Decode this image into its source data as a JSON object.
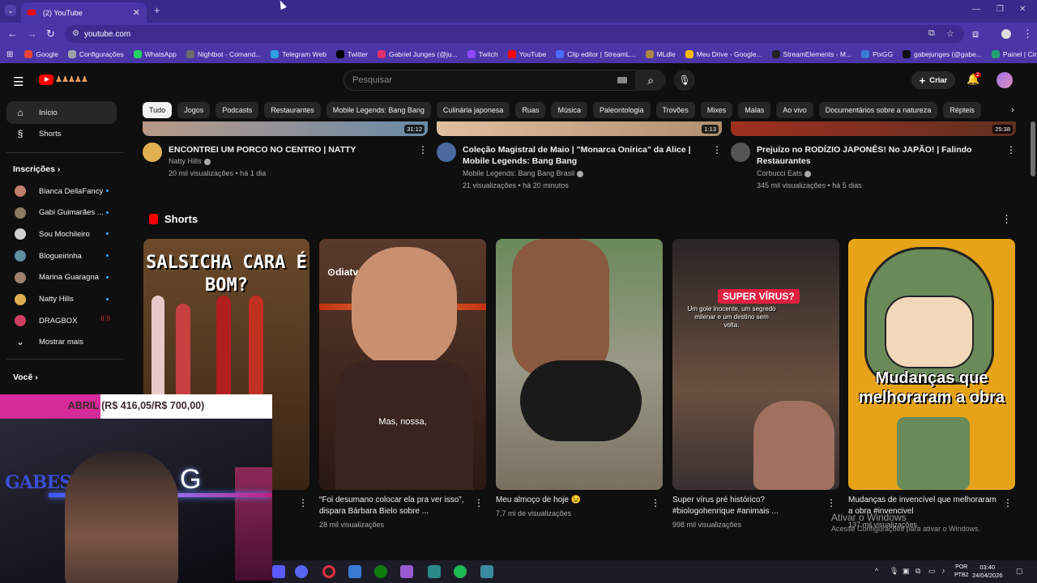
{
  "browser": {
    "tab_title": "(2) YouTube",
    "url": "youtube.com",
    "bookmarks": [
      {
        "label": "Google",
        "color": "#ea4335"
      },
      {
        "label": "Configurações",
        "color": "#9aa0a6"
      },
      {
        "label": "WhatsApp",
        "color": "#25d366"
      },
      {
        "label": "Nightbot - Comand...",
        "color": "#6b6b6b"
      },
      {
        "label": "Telegram Web",
        "color": "#2aa3e0"
      },
      {
        "label": "Twitter",
        "color": "#000000"
      },
      {
        "label": "Gabriel Junges (@ju...",
        "color": "#e1306c"
      },
      {
        "label": "Twitch",
        "color": "#9146ff"
      },
      {
        "label": "YouTube",
        "color": "#ff0000"
      },
      {
        "label": "Clip editor | StreamL...",
        "color": "#4b6cff"
      },
      {
        "label": "MLdle",
        "color": "#aa8844"
      },
      {
        "label": "Meu Drive - Google...",
        "color": "#fbbc04"
      },
      {
        "label": "StreamElements - M...",
        "color": "#222222"
      },
      {
        "label": "PixGG",
        "color": "#3a7bd5"
      },
      {
        "label": "gabejunges (@gabe...",
        "color": "#111111"
      },
      {
        "label": "Painel | Cinefy",
        "color": "#20a070"
      }
    ]
  },
  "header": {
    "search_placeholder": "Pesquisar",
    "create_label": "Criar",
    "notif_count": "2"
  },
  "sidebar": {
    "home": "Início",
    "shorts": "Shorts",
    "subscriptions_title": "Inscrições",
    "subscriptions": [
      {
        "name": "Bianca DellaFancy",
        "color": "#c08070"
      },
      {
        "name": "Gabi Guimarães ...",
        "color": "#8a7a60"
      },
      {
        "name": "Sou Mochileiro",
        "color": "#d0d0d0"
      },
      {
        "name": "Blogueirinha",
        "color": "#6090a0"
      },
      {
        "name": "Marina Guaragna",
        "color": "#a08070"
      },
      {
        "name": "Natty Hills",
        "color": "#e0b050"
      },
      {
        "name": "DRAGBOX",
        "color": "#d04060"
      }
    ],
    "show_more": "Mostrar mais",
    "you_title": "Você"
  },
  "chips": [
    "Tudo",
    "Jogos",
    "Podcasts",
    "Restaurantes",
    "Mobile Legends: Bang Bang",
    "Culinária japonesa",
    "Ruas",
    "Música",
    "Paleontologia",
    "Trovões",
    "Mixes",
    "Malas",
    "Ao vivo",
    "Documentários sobre a natureza",
    "Répteis"
  ],
  "videos": [
    {
      "duration": "31:12",
      "title": "ENCONTREI UM PORCO NO CENTRO | NATTY",
      "channel": "Natty Hills",
      "meta": "20 mil visualizações • há 1 dia",
      "avatar": "#e0b050"
    },
    {
      "duration": "1:13",
      "title": "Coleção Magistral de Maio | \"Monarca Onírica\" da Alice | Mobile Legends: Bang Bang",
      "channel": "Mobile Legends: Bang Bang Brasil",
      "meta": "21 visualizações • há 20 minutos",
      "avatar": "#4a6aa0"
    },
    {
      "duration": "25:38",
      "title": "Prejuízo no RODÍZIO JAPONÊS! No JAPÃO! | Falindo Restaurantes",
      "channel": "Corbucci Eats",
      "meta": "345 mil visualizações • há 5 dias",
      "avatar": "#555555"
    }
  ],
  "shorts": {
    "title": "Shorts",
    "items": [
      {
        "thumb_text": "SALSICHA CARA É BOM?",
        "caption": "",
        "views": "",
        "bg": "#6b4a2a"
      },
      {
        "thumb_text": "Mas, nossa,",
        "brand": "diatv",
        "caption": "“Foi desumano colocar ela pra ver isso”, dispara Bárbara Bielo sobre ...",
        "views": "28 mil visualizações",
        "bg": "#4a2a22"
      },
      {
        "thumb_text": "",
        "caption": "Meu almoço de hoje 😉",
        "views": "7,7 mi de visualizações",
        "bg": "#8a8a78"
      },
      {
        "thumb_text": "SUPER VÍRUS?",
        "subtext": "Um gole inocente, um segredo milenar e um destino sem volta.",
        "caption": "Super vírus pré histórico? #biologohenrique #animais ...",
        "views": "998 mil visualizações",
        "bg": "#3a3030"
      },
      {
        "thumb_text": "Mudanças que melhoraram a obra",
        "caption": "Mudanças de invencível que melhoraram a obra #invencivel",
        "views": "137 mil visualizações",
        "bg": "#e6a318"
      }
    ]
  },
  "stream_overlay": {
    "goal_text": "ABRIL (R$ 416,05/R$ 700,00)",
    "progress": 0.594,
    "webcam_label": "GABES"
  },
  "taskbar": {
    "lang": "POR\nPTB2",
    "time": "03:40",
    "date": "24/04/2026"
  },
  "watermark": {
    "line1": "Ativar o Windows",
    "line2": "Acesse Configurações para ativar o Windows."
  }
}
